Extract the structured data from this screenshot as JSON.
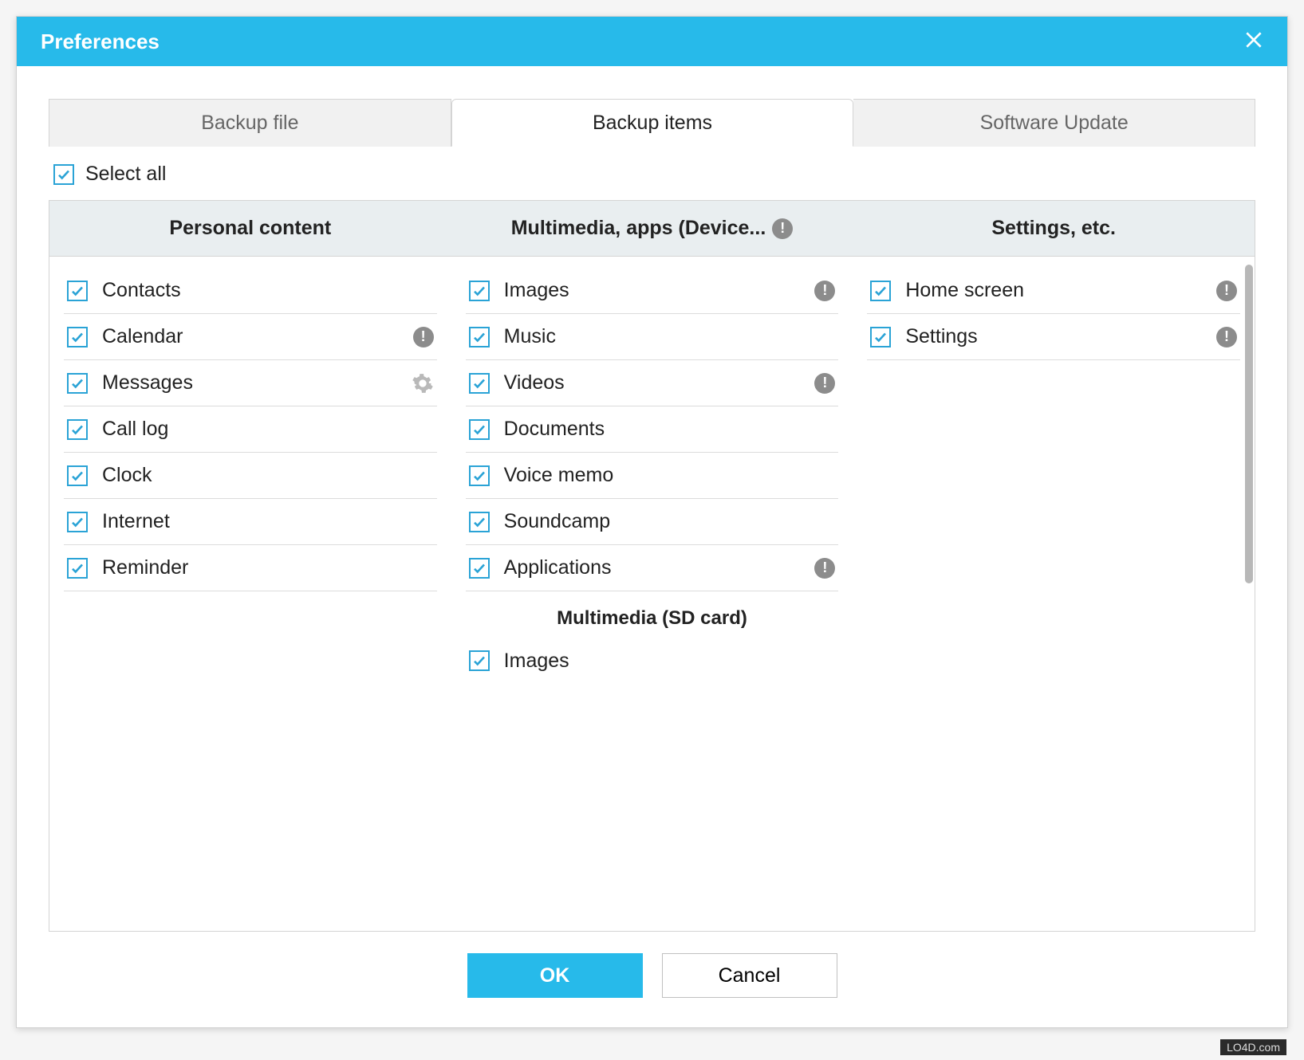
{
  "window": {
    "title": "Preferences"
  },
  "tabs": {
    "items": [
      {
        "label": "Backup file",
        "active": false
      },
      {
        "label": "Backup items",
        "active": true
      },
      {
        "label": "Software Update",
        "active": false
      }
    ]
  },
  "select_all": {
    "label": "Select all",
    "checked": true
  },
  "columns": [
    {
      "title": "Personal content",
      "info": false
    },
    {
      "title": "Multimedia, apps (Device...",
      "info": true
    },
    {
      "title": "Settings, etc.",
      "info": false
    }
  ],
  "personal": [
    {
      "label": "Contacts",
      "checked": true,
      "icon": null
    },
    {
      "label": "Calendar",
      "checked": true,
      "icon": "info"
    },
    {
      "label": "Messages",
      "checked": true,
      "icon": "gear"
    },
    {
      "label": "Call log",
      "checked": true,
      "icon": null
    },
    {
      "label": "Clock",
      "checked": true,
      "icon": null
    },
    {
      "label": "Internet",
      "checked": true,
      "icon": null
    },
    {
      "label": "Reminder",
      "checked": true,
      "icon": null
    }
  ],
  "multimedia": [
    {
      "label": "Images",
      "checked": true,
      "icon": "info"
    },
    {
      "label": "Music",
      "checked": true,
      "icon": null
    },
    {
      "label": "Videos",
      "checked": true,
      "icon": "info"
    },
    {
      "label": "Documents",
      "checked": true,
      "icon": null
    },
    {
      "label": "Voice memo",
      "checked": true,
      "icon": null
    },
    {
      "label": "Soundcamp",
      "checked": true,
      "icon": null
    },
    {
      "label": "Applications",
      "checked": true,
      "icon": "info"
    }
  ],
  "multimedia_sd_header": "Multimedia (SD card)",
  "multimedia_sd": [
    {
      "label": "Images",
      "checked": true,
      "icon": null
    }
  ],
  "settings": [
    {
      "label": "Home screen",
      "checked": true,
      "icon": "info"
    },
    {
      "label": "Settings",
      "checked": true,
      "icon": "info"
    }
  ],
  "buttons": {
    "ok": "OK",
    "cancel": "Cancel"
  },
  "watermark": "LO4D.com"
}
